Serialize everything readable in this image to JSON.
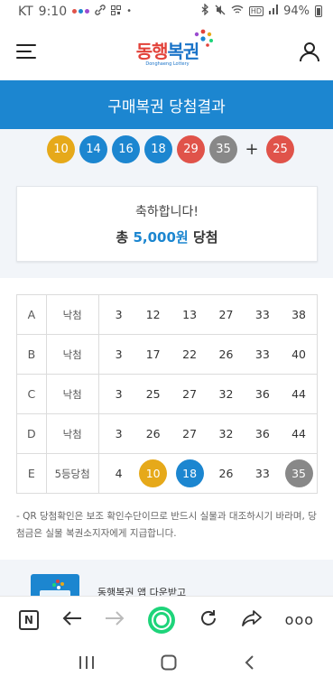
{
  "status_bar": {
    "carrier": "KT",
    "time": "9:10",
    "battery": "94%"
  },
  "header": {
    "logo_text_a": "동행",
    "logo_text_b": "복권",
    "logo_sub": "Donghaeng Lottery"
  },
  "title": "구매복권 당첨결과",
  "winning_numbers": [
    {
      "n": "10",
      "color": "#e6a91a"
    },
    {
      "n": "14",
      "color": "#1c86d0"
    },
    {
      "n": "16",
      "color": "#1c86d0"
    },
    {
      "n": "18",
      "color": "#1c86d0"
    },
    {
      "n": "29",
      "color": "#e0534a"
    },
    {
      "n": "35",
      "color": "#888888"
    }
  ],
  "bonus_plus": "+",
  "bonus_number": {
    "n": "25",
    "color": "#e0534a"
  },
  "result": {
    "congrats": "축하합니다!",
    "prize_prefix": "총",
    "prize_amount": "5,000원",
    "prize_suffix": "당첨"
  },
  "ticket_rows": [
    {
      "label": "A",
      "status": "낙첨",
      "nums": [
        "3",
        "12",
        "13",
        "27",
        "33",
        "38"
      ]
    },
    {
      "label": "B",
      "status": "낙첨",
      "nums": [
        "3",
        "17",
        "22",
        "26",
        "33",
        "40"
      ]
    },
    {
      "label": "C",
      "status": "낙첨",
      "nums": [
        "3",
        "25",
        "27",
        "32",
        "36",
        "44"
      ]
    },
    {
      "label": "D",
      "status": "낙첨",
      "nums": [
        "3",
        "26",
        "27",
        "32",
        "36",
        "44"
      ]
    },
    {
      "label": "E",
      "status": "5등당첨",
      "nums": [
        "4",
        "10",
        "18",
        "26",
        "33",
        "35"
      ]
    }
  ],
  "match_colors": {
    "10": "#e6a91a",
    "18": "#1c86d0",
    "35": "#888888"
  },
  "note": "- QR 당첨확인은 보조 확인수단이므로 반드시 실물과 대조하시기 바라며, 당첨금은 실물 복권소지자에게 지급합니다.",
  "app_banner": {
    "text": "동행복권 앱 다운받고"
  },
  "browser": {
    "n_label": "N",
    "more": "ooo"
  }
}
